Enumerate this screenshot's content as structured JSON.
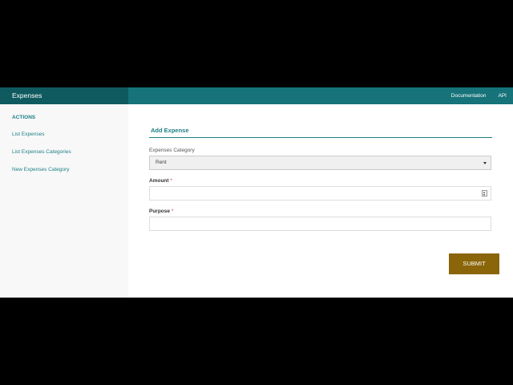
{
  "header": {
    "app_title": "Expenses",
    "nav": {
      "documentation": "Documentation",
      "api": "API"
    }
  },
  "sidebar": {
    "heading": "ACTIONS",
    "items": [
      {
        "label": "List Expenses"
      },
      {
        "label": "List Expenses Categories"
      },
      {
        "label": "New Expenses Category"
      }
    ]
  },
  "form": {
    "title": "Add Expense",
    "category": {
      "label": "Expenses Category",
      "selected": "Rent"
    },
    "amount": {
      "label": "Amount",
      "required_marker": "*",
      "value": ""
    },
    "purpose": {
      "label": "Purpose",
      "required_marker": "*",
      "value": ""
    },
    "submit_label": "SUBMIT"
  },
  "colors": {
    "topbar": "#157379",
    "brand_bg": "#0f5a5f",
    "accent": "#1d7f86",
    "submit_button": "#8a6509",
    "sidebar_bg": "#f8f8f8"
  },
  "icons": {
    "select_caret": "caret-down-icon",
    "number_spinner": "spinner-icon"
  }
}
